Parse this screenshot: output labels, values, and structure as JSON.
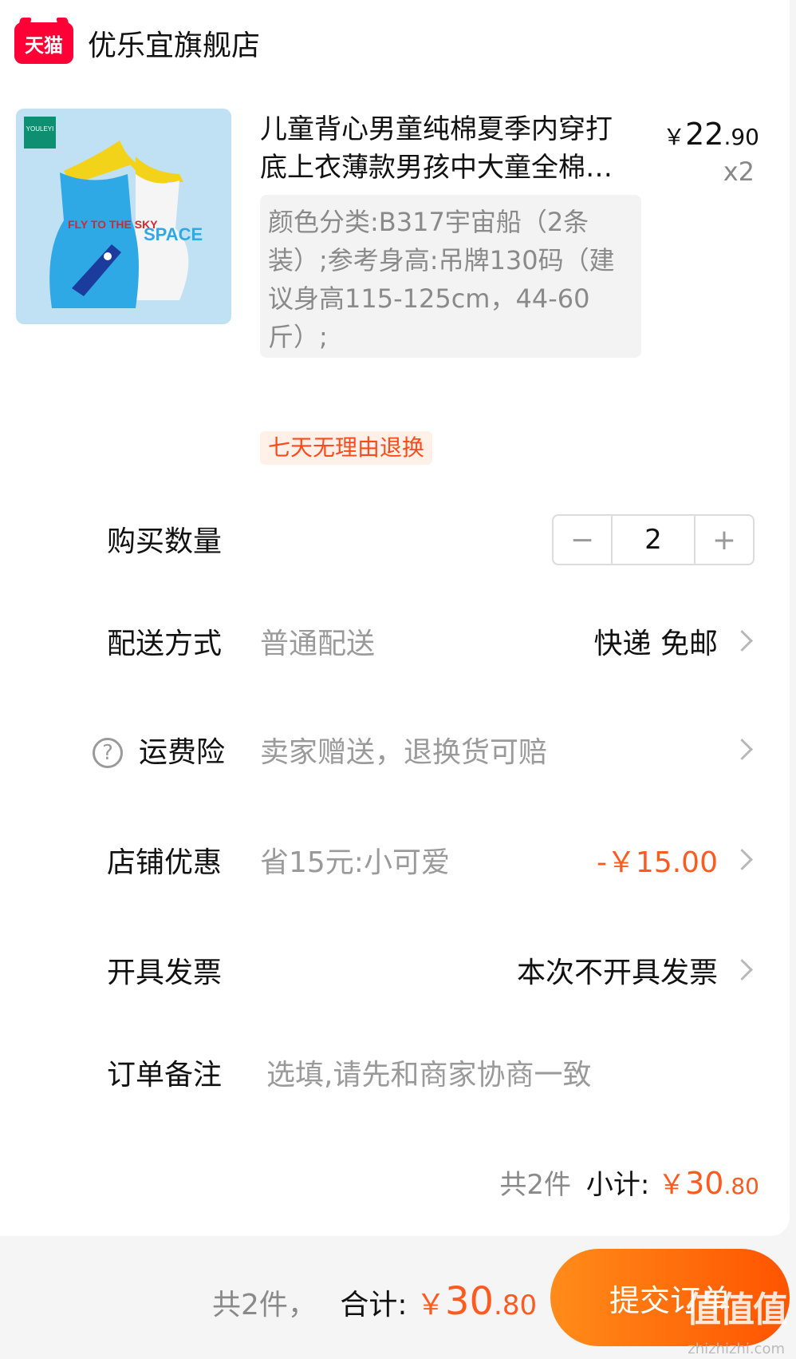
{
  "store": {
    "logo_text": "天猫",
    "name": "优乐宜旗舰店"
  },
  "product": {
    "image_brand": "YOULEYI",
    "image_text_1": "FLY TO THE SKY",
    "image_text_2": "SPACE",
    "title": "儿童背心男童纯棉夏季内穿打底上衣薄款男孩中大童全棉…",
    "price_symbol": "￥",
    "price_int": "22",
    "price_dec": ".90",
    "quantity_label": "x2",
    "sku": "颜色分类:B317宇宙船（2条装）;参考身高:吊牌130码（建议身高115-125cm，44-60斤）;",
    "return_policy": "七天无理由退换"
  },
  "quantity_row": {
    "label": "购买数量",
    "minus": "−",
    "value": "2",
    "plus": "+"
  },
  "shipping_row": {
    "label": "配送方式",
    "sub": "普通配送",
    "value": "快递 免邮"
  },
  "insurance_row": {
    "icon": "?",
    "label": "运费险",
    "sub": "卖家赠送，退换货可赔"
  },
  "discount_row": {
    "label": "店铺优惠",
    "sub": "省15元:小可爱",
    "value": "-￥15.00"
  },
  "invoice_row": {
    "label": "开具发票",
    "value": "本次不开具发票"
  },
  "note_row": {
    "label": "订单备注",
    "placeholder": "选填,请先和商家协商一致"
  },
  "subtotal": {
    "count": "共2件",
    "label": "小计:",
    "symbol": "￥",
    "int": "30",
    "dec": ".80"
  },
  "footer": {
    "count": "共2件，",
    "label": "合计:",
    "symbol": "￥",
    "int": "30",
    "dec": ".80",
    "submit": "提交订单",
    "watermark": "值值值",
    "watermark_url": "zhizhizhi.com"
  },
  "colors": {
    "accent": "#ff5a1f",
    "tmall_red": "#ff0036",
    "button_start": "#ff8c1a",
    "button_end": "#ff5400"
  }
}
